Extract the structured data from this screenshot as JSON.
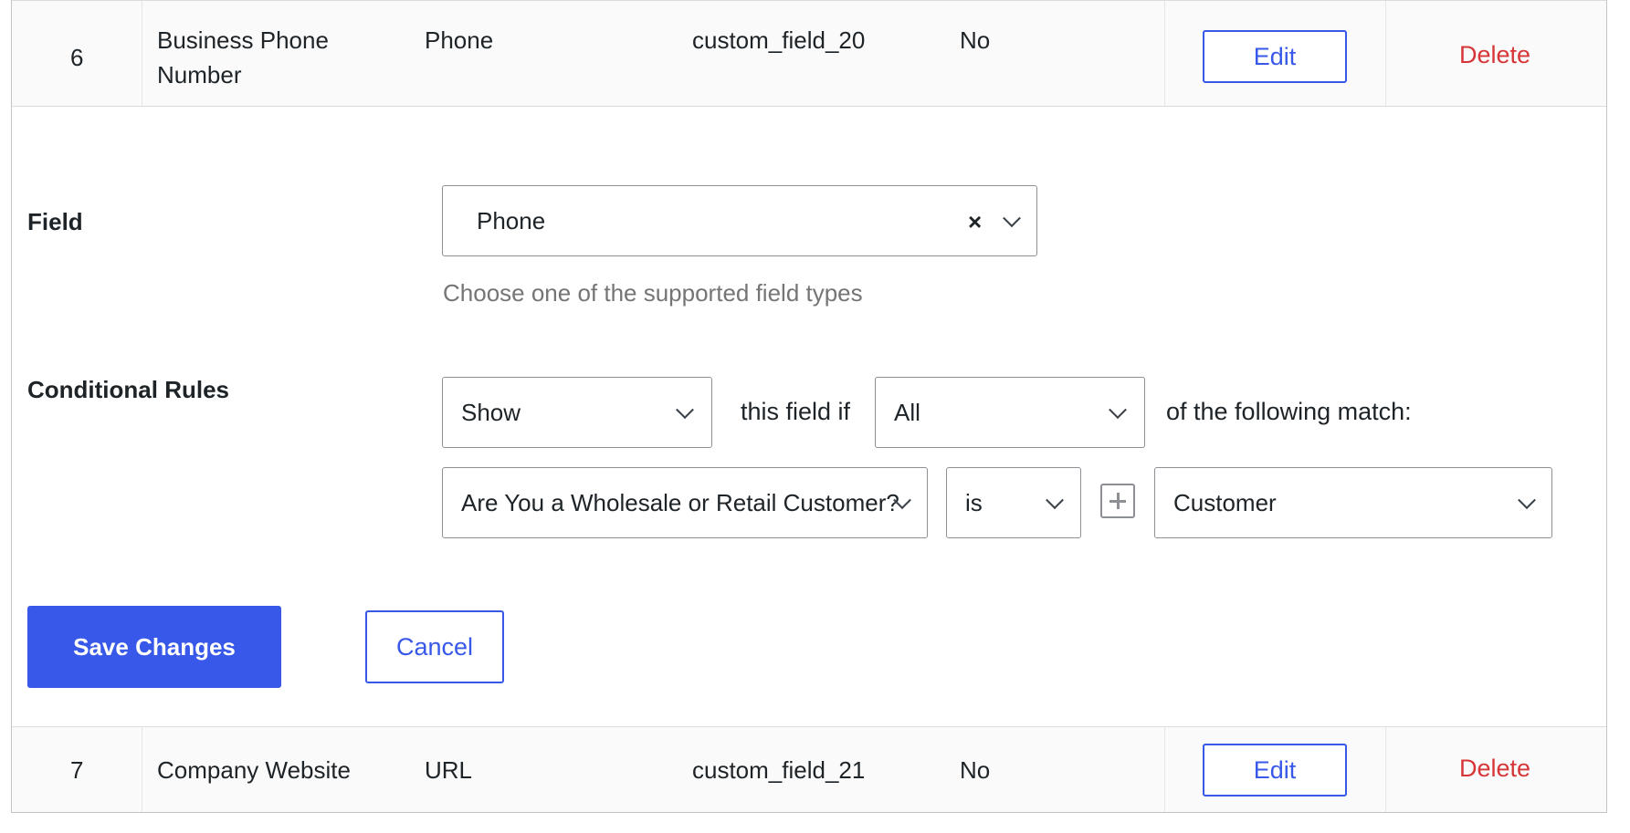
{
  "rows": [
    {
      "number": "6",
      "name": "Business Phone Number",
      "name_line1": "Business Phone",
      "name_line2": "Number",
      "type": "Phone",
      "key": "custom_field_20",
      "required": "No",
      "edit_label": "Edit",
      "delete_label": "Delete"
    },
    {
      "number": "7",
      "name": "Company Website",
      "type": "URL",
      "key": "custom_field_21",
      "required": "No",
      "edit_label": "Edit",
      "delete_label": "Delete"
    }
  ],
  "editor": {
    "field_label": "Field",
    "field_value": "Phone",
    "field_clear_icon": "×",
    "field_help": "Choose one of the supported field types",
    "rules_label": "Conditional Rules",
    "rule_action": "Show",
    "text_this_field_if": "this field if",
    "rule_match": "All",
    "text_following_match": "of the following match:",
    "condition_field": "Are You a Wholesale or Retail Customer?",
    "condition_operator": "is",
    "condition_value": "Customer",
    "add_condition_icon": "plus-icon",
    "save_label": "Save Changes",
    "cancel_label": "Cancel"
  },
  "colors": {
    "accent": "#3858e9",
    "danger": "#d63638",
    "help": "#757575"
  }
}
